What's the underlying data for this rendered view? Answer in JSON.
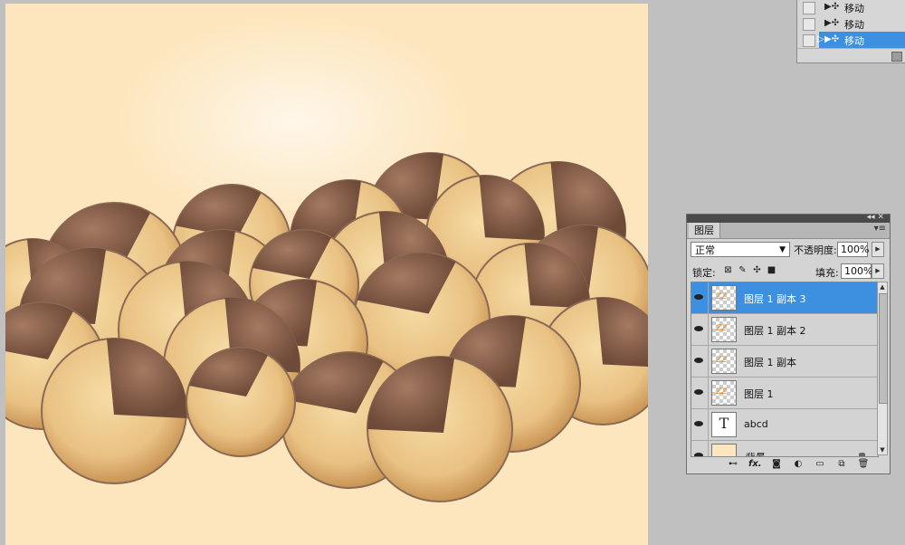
{
  "history": {
    "items": [
      {
        "label": "移动",
        "icon": "move-tool-icon",
        "active": false
      },
      {
        "label": "移动",
        "icon": "move-tool-icon",
        "active": false
      },
      {
        "label": "移动",
        "icon": "move-tool-icon",
        "active": true
      }
    ]
  },
  "layers_panel": {
    "tab_label": "图层",
    "blend_mode": "正常",
    "opacity_label": "不透明度:",
    "opacity_value": "100%",
    "lock_label": "锁定:",
    "fill_label": "填充:",
    "fill_value": "100%",
    "layers": [
      {
        "name": "图层 1 副本 3",
        "selected": true,
        "thumb": "transparent"
      },
      {
        "name": "图层 1 副本 2",
        "selected": false,
        "thumb": "transparent"
      },
      {
        "name": "图层 1 副本",
        "selected": false,
        "thumb": "transparent"
      },
      {
        "name": "图层 1",
        "selected": false,
        "thumb": "transparent"
      },
      {
        "name": "abcd",
        "selected": false,
        "thumb": "text",
        "thumb_text": "T"
      },
      {
        "name": "背景",
        "selected": false,
        "thumb": "background",
        "locked": true
      }
    ],
    "bottom_icons": [
      "link-layers-icon",
      "fx-icon",
      "mask-icon",
      "adjustment-icon",
      "group-icon",
      "new-layer-icon",
      "trash-icon"
    ],
    "bottom_fx_text": "fx."
  },
  "colors": {
    "canvas_bg": "#fde6bd",
    "selection_blue": "#3d8fe0",
    "panel_gray": "#d4d4d4"
  }
}
